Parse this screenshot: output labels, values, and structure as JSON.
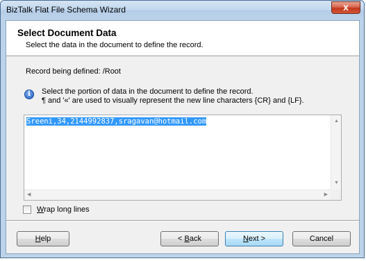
{
  "window": {
    "title": "BizTalk Flat File Schema Wizard",
    "close_glyph": "x"
  },
  "header": {
    "title": "Select Document Data",
    "subtitle": "Select the data in the document to define the record."
  },
  "record": {
    "text": "Record being defined: /Root"
  },
  "info": {
    "icon": "info-icon",
    "line1": "Select the portion of data in the document to define the record.",
    "line2": "¶ and '«' are used to visually represent the new line characters {CR} and {LF}."
  },
  "document": {
    "selected_text": "Sreeni,34,2144992837,sragavan@hotmail.com"
  },
  "wrap": {
    "label_underlined": "W",
    "label_rest": "rap long lines",
    "checked": false
  },
  "buttons": {
    "help": {
      "underlined": "H",
      "rest": "elp"
    },
    "back": {
      "prefix": "< ",
      "underlined": "B",
      "rest": "ack"
    },
    "next": {
      "underlined": "N",
      "rest": "ext >"
    },
    "cancel": {
      "label": "Cancel"
    }
  },
  "colors": {
    "selection": "#3399ff",
    "frame": "#bcd3ea",
    "close_button": "#c2381d"
  }
}
